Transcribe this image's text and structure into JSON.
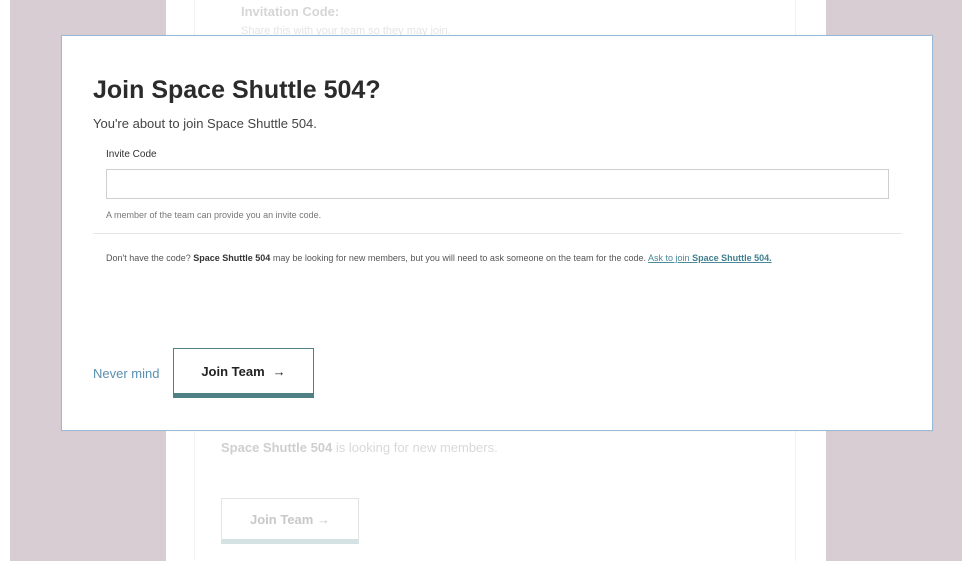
{
  "background": {
    "invite_title": "Invitation Code:",
    "invite_sub": "Share this with your team so they may join.",
    "looking_team": "Space Shuttle 504",
    "looking_text": " is looking for new members.",
    "join_button": "Join Team",
    "arrow": "→"
  },
  "modal": {
    "title": "Join Space Shuttle 504?",
    "subtitle": "You're about to join Space Shuttle 504.",
    "invite_label": "Invite Code",
    "invite_value": "",
    "invite_placeholder": "",
    "help_text": "A member of the team can provide you an invite code.",
    "info_prefix": "Don't have the code? ",
    "info_team": "Space Shuttle 504",
    "info_mid": " may be looking for new members, but you will need to ask someone on the team for the code. ",
    "ask_prefix": "Ask to join ",
    "ask_team": "Space Shuttle 504.",
    "never_mind": "Never mind",
    "join_button": "Join Team",
    "arrow": "→"
  },
  "colors": {
    "accent": "#4e8086",
    "link": "#5a8fb0",
    "backdrop": "#d8cdd2"
  }
}
